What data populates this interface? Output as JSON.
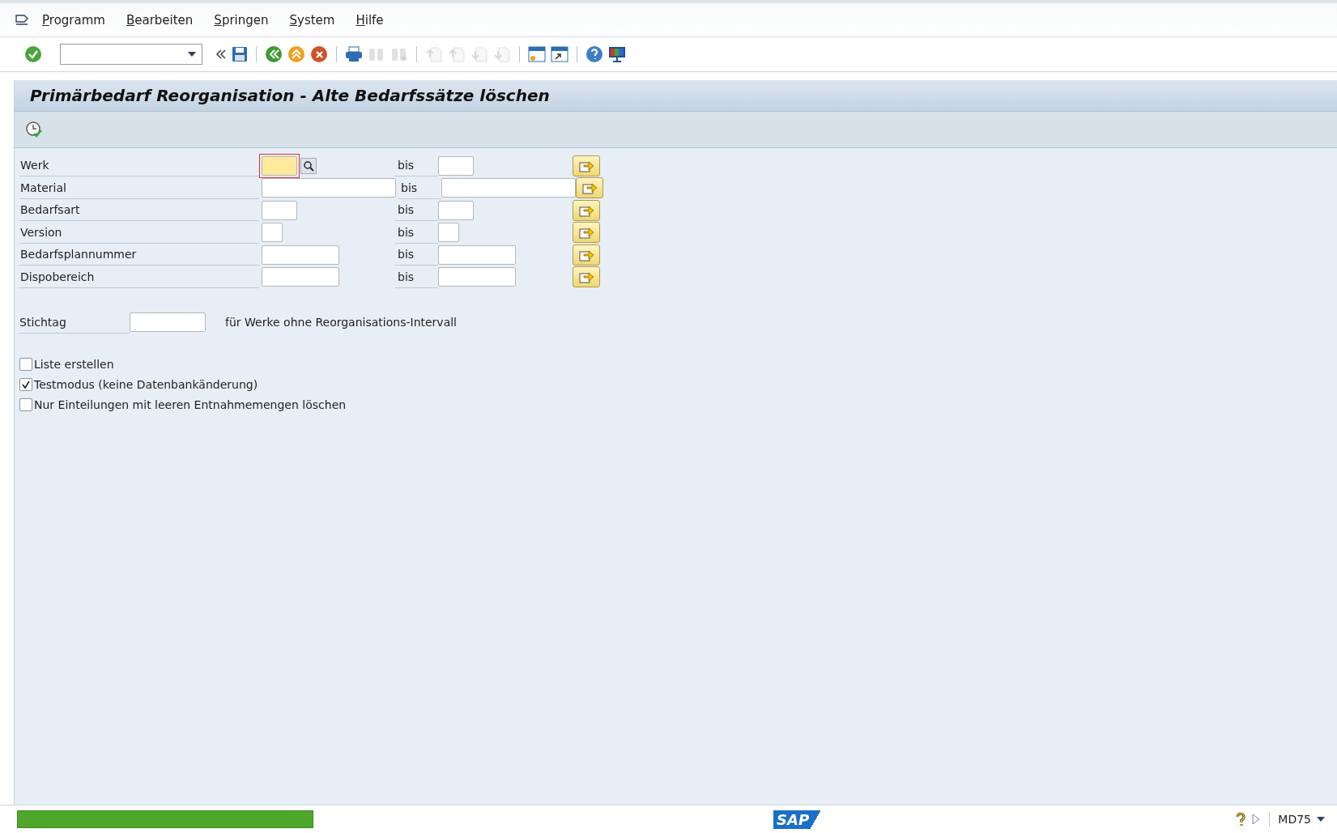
{
  "menu": [
    "Programm",
    "Bearbeiten",
    "Springen",
    "System",
    "Hilfe"
  ],
  "toolbar": {
    "buttons": [
      {
        "kind": "enter",
        "disabled": false
      },
      {
        "kind": "field"
      },
      {
        "kind": "collapse",
        "disabled": false
      },
      {
        "kind": "save",
        "disabled": false
      },
      {
        "kind": "sep"
      },
      {
        "kind": "back",
        "disabled": false
      },
      {
        "kind": "exit",
        "disabled": false
      },
      {
        "kind": "cancel",
        "disabled": false
      },
      {
        "kind": "sep"
      },
      {
        "kind": "print",
        "disabled": false
      },
      {
        "kind": "find",
        "disabled": true
      },
      {
        "kind": "find-next",
        "disabled": true
      },
      {
        "kind": "sep"
      },
      {
        "kind": "first-page",
        "disabled": true
      },
      {
        "kind": "prev-page",
        "disabled": true
      },
      {
        "kind": "next-page",
        "disabled": true
      },
      {
        "kind": "last-page",
        "disabled": true
      },
      {
        "kind": "sep"
      },
      {
        "kind": "new-session",
        "disabled": false
      },
      {
        "kind": "shortcut",
        "disabled": false
      },
      {
        "kind": "sep"
      },
      {
        "kind": "help",
        "disabled": false
      },
      {
        "kind": "layout",
        "disabled": false
      }
    ]
  },
  "title": "Primärbedarf Reorganisation - Alte Bedarfssätze löschen",
  "selections": [
    {
      "label": "Werk",
      "focused": true,
      "search_help": true,
      "to_label": "bis"
    },
    {
      "label": "Material",
      "focused": false,
      "search_help": false,
      "to_label": "bis"
    },
    {
      "label": "Bedarfsart",
      "focused": false,
      "search_help": false,
      "to_label": "bis"
    },
    {
      "label": "Version",
      "focused": false,
      "search_help": false,
      "to_label": "bis"
    },
    {
      "label": "Bedarfsplannummer",
      "focused": false,
      "search_help": false,
      "to_label": "bis"
    },
    {
      "label": "Dispobereich",
      "focused": false,
      "search_help": false,
      "to_label": "bis"
    }
  ],
  "key_date": {
    "label": "Stichtag",
    "note": "für Werke ohne Reorganisations-Intervall"
  },
  "options": [
    {
      "label": "Liste erstellen",
      "checked": false
    },
    {
      "label": "Testmodus (keine Datenbankänderung)",
      "checked": true
    },
    {
      "label": "Nur Einteilungen mit leeren Entnahmemengen löschen",
      "checked": false
    }
  ],
  "status_bar": {
    "logo": "SAP",
    "transaction": "MD75"
  }
}
